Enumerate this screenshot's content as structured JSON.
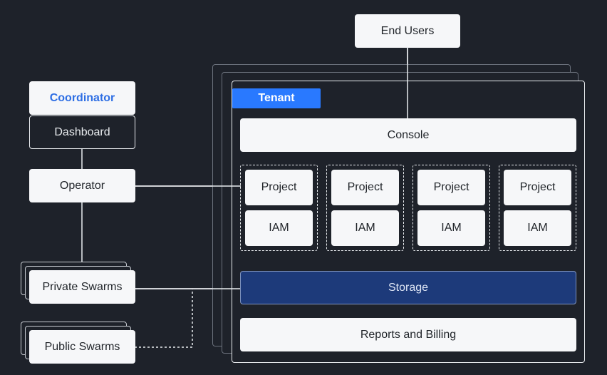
{
  "end_users": "End Users",
  "coordinator": {
    "title": "Coordinator",
    "dashboard": "Dashboard",
    "operator": "Operator"
  },
  "swarms": {
    "private": "Private Swarms",
    "public": "Public Swarms"
  },
  "tenant": {
    "label": "Tenant",
    "console": "Console",
    "groups": [
      {
        "project": "Project",
        "iam": "IAM"
      },
      {
        "project": "Project",
        "iam": "IAM"
      },
      {
        "project": "Project",
        "iam": "IAM"
      },
      {
        "project": "Project",
        "iam": "IAM"
      }
    ],
    "storage": "Storage",
    "reports": "Reports and Billing"
  },
  "colors": {
    "background": "#1e222a",
    "accent": "#2979ff",
    "storage": "#1d3a7a",
    "box": "#f6f7f9"
  }
}
